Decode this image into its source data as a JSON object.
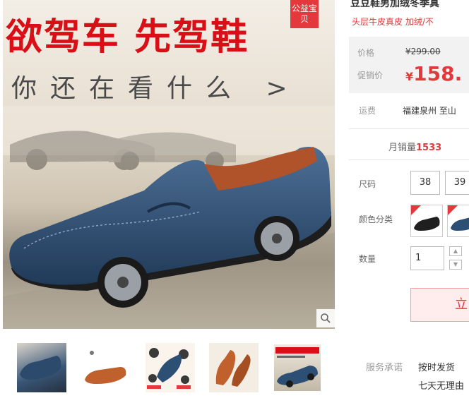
{
  "gallery": {
    "headline": "欲驾车 先驾鞋",
    "subline": "你还在看什么 >",
    "badge": "公益宝贝",
    "thumbnails": [
      {
        "name": "thumb-blue-loafer-angle"
      },
      {
        "name": "thumb-brown-loafer-brand"
      },
      {
        "name": "thumb-loafer-features"
      },
      {
        "name": "thumb-brown-loafer-side"
      },
      {
        "name": "thumb-main-poster"
      }
    ]
  },
  "product": {
    "title": "豆豆鞋男加绒冬季真",
    "subtitle": "头层牛皮真皮 加绒/不",
    "price_label": "价格",
    "original_price": "¥299.00",
    "promo_label": "促销价",
    "currency": "¥",
    "promo_price": "158.",
    "shipping_label": "运费",
    "shipping_value": "福建泉州 至山",
    "monthly_sales_label": "月销量",
    "monthly_sales_value": "1533",
    "size_label": "尺码",
    "sizes": [
      "38",
      "39"
    ],
    "color_label": "颜色分类",
    "quantity_label": "数量",
    "quantity_value": "1",
    "buy_button": "立",
    "service_label": "服务承诺",
    "service_items": [
      "按时发货",
      "七天无理由"
    ]
  },
  "colors": {
    "accent": "#e4393c",
    "headline": "#d90f17",
    "shoe": "#2e4f74"
  }
}
